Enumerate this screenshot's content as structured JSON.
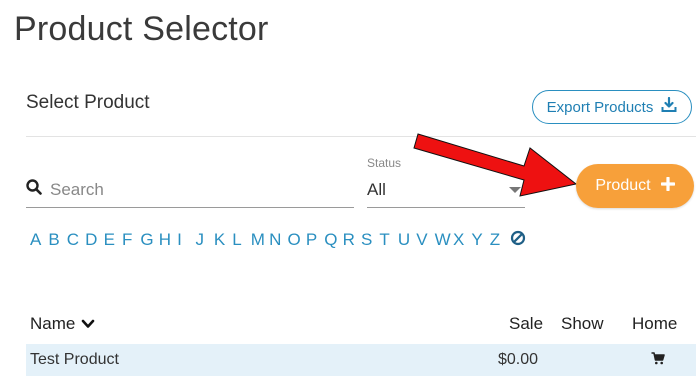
{
  "page": {
    "title": "Product Selector"
  },
  "section": {
    "title": "Select Product"
  },
  "toolbar": {
    "export_label": "Export Products",
    "product_label": "Product"
  },
  "search": {
    "placeholder": "Search",
    "value": ""
  },
  "status": {
    "label": "Status",
    "selected": "All"
  },
  "alphabet": [
    "A",
    "B",
    "C",
    "D",
    "E",
    "F",
    "G",
    "H",
    "I",
    "J",
    "K",
    "L",
    "M",
    "N",
    "O",
    "P",
    "Q",
    "R",
    "S",
    "T",
    "U",
    "V",
    "W",
    "X",
    "Y",
    "Z"
  ],
  "table": {
    "headers": {
      "name": "Name",
      "sale": "Sale",
      "show": "Show",
      "home": "Home"
    },
    "rows": [
      {
        "name": "Test Product",
        "sale": "$0.00",
        "show": "",
        "home_icon": "cart-icon"
      }
    ]
  },
  "colors": {
    "accent_blue": "#2a8fc0",
    "accent_orange": "#f7a03a",
    "arrow_red": "#ee1111",
    "row_highlight": "#e4f1f9"
  },
  "icons": {
    "export": "download-icon",
    "search": "search-icon",
    "add": "plus-icon",
    "sort": "chevron-down-icon",
    "clear": "no-filter-icon"
  }
}
